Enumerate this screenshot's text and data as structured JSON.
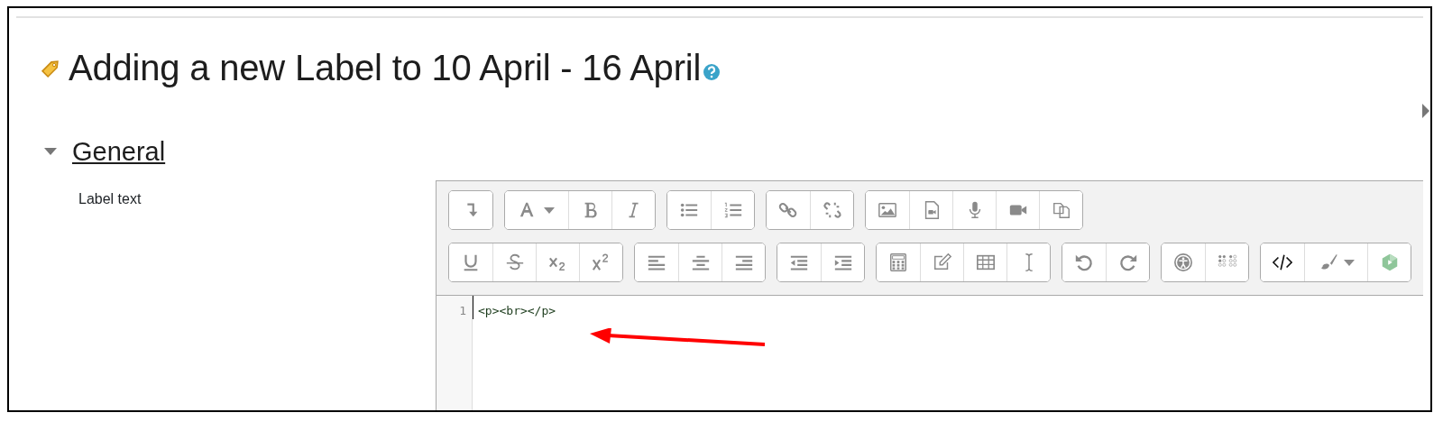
{
  "page": {
    "title": "Adding a new Label to 10 April - 16 April"
  },
  "section": {
    "title": "General",
    "expanded": true
  },
  "form": {
    "field_label": "Label text"
  },
  "editor": {
    "toolbar_rows": [
      [
        [
          {
            "kind": "collapse"
          }
        ],
        [
          {
            "kind": "font"
          },
          {
            "kind": "bold"
          },
          {
            "kind": "italic"
          }
        ],
        [
          {
            "kind": "bullets"
          },
          {
            "kind": "numbers"
          }
        ],
        [
          {
            "kind": "link"
          },
          {
            "kind": "unlink"
          }
        ],
        [
          {
            "kind": "image"
          },
          {
            "kind": "media"
          },
          {
            "kind": "mic"
          },
          {
            "kind": "video"
          },
          {
            "kind": "copy"
          }
        ]
      ],
      [
        [
          {
            "kind": "underline"
          },
          {
            "kind": "strike"
          },
          {
            "kind": "sub"
          },
          {
            "kind": "sup"
          }
        ],
        [
          {
            "kind": "align-left"
          },
          {
            "kind": "align-center"
          },
          {
            "kind": "align-right"
          }
        ],
        [
          {
            "kind": "outdent"
          },
          {
            "kind": "indent"
          }
        ],
        [
          {
            "kind": "calculator"
          },
          {
            "kind": "edit"
          },
          {
            "kind": "table"
          },
          {
            "kind": "cursor"
          }
        ],
        [
          {
            "kind": "undo"
          },
          {
            "kind": "redo"
          }
        ],
        [
          {
            "kind": "accessibility"
          },
          {
            "kind": "braille"
          }
        ],
        [
          {
            "kind": "html"
          },
          {
            "kind": "brush"
          },
          {
            "kind": "h5p"
          }
        ]
      ]
    ],
    "lines": [
      {
        "number": "1",
        "code": "<p><br></p>"
      }
    ]
  },
  "annotations": [
    {
      "kind": "arrow",
      "color": "#ff0000"
    }
  ]
}
